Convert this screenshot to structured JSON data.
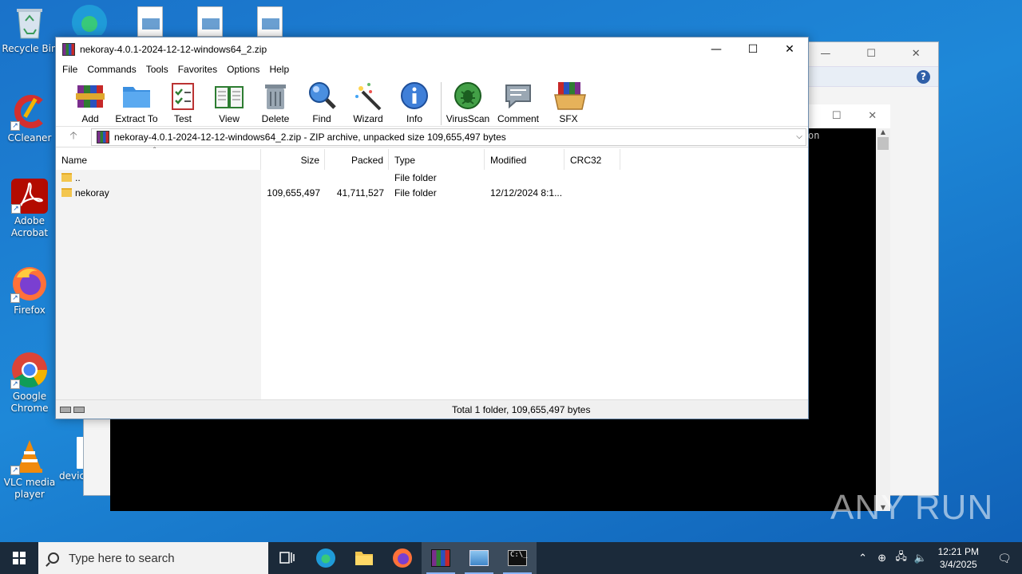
{
  "desktop": {
    "icons": [
      {
        "label": "Recycle Bin"
      },
      {
        "label": "CCleaner"
      },
      {
        "label": "Adobe Acrobat"
      },
      {
        "label": "Firefox"
      },
      {
        "label": "Google Chrome"
      },
      {
        "label": "VLC media player"
      },
      {
        "label": "devic"
      }
    ],
    "console_text": "on"
  },
  "window": {
    "title": "nekoray-4.0.1-2024-12-12-windows64_2.zip",
    "menu": [
      "File",
      "Commands",
      "Tools",
      "Favorites",
      "Options",
      "Help"
    ],
    "toolbar": [
      "Add",
      "Extract To",
      "Test",
      "View",
      "Delete",
      "Find",
      "Wizard",
      "Info",
      "VirusScan",
      "Comment",
      "SFX"
    ],
    "address": "nekoray-4.0.1-2024-12-12-windows64_2.zip - ZIP archive, unpacked size 109,655,497 bytes",
    "columns": {
      "name": "Name",
      "size": "Size",
      "packed": "Packed",
      "type": "Type",
      "modified": "Modified",
      "crc": "CRC32"
    },
    "rows": [
      {
        "name": "..",
        "size": "",
        "packed": "",
        "type": "File folder",
        "modified": "",
        "crc": ""
      },
      {
        "name": "nekoray",
        "size": "109,655,497",
        "packed": "41,711,527",
        "type": "File folder",
        "modified": "12/12/2024 8:1...",
        "crc": ""
      }
    ],
    "status": "Total 1 folder, 109,655,497 bytes"
  },
  "taskbar": {
    "search_placeholder": "Type here to search",
    "time": "12:21 PM",
    "date": "3/4/2025"
  },
  "watermark": "ANY RUN"
}
